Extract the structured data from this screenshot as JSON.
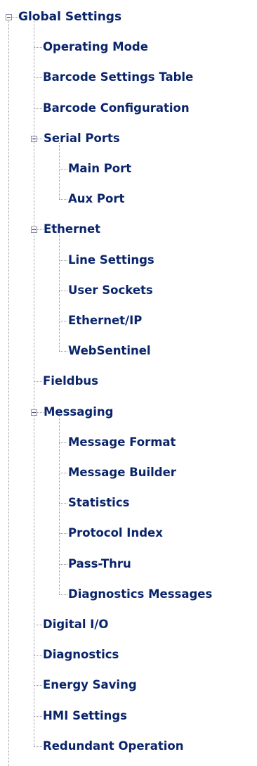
{
  "tree": {
    "colors": {
      "text": "#0a246a",
      "connector": "#9a9aa6",
      "expander_border": "#8a8aa0",
      "background": "#ffffff"
    },
    "icons": {
      "expander": "collapse-minus-box-icon"
    },
    "root": {
      "label": "Global Settings",
      "expanded": true,
      "children": [
        {
          "label": "Operating Mode"
        },
        {
          "label": "Barcode Settings Table"
        },
        {
          "label": "Barcode Configuration"
        },
        {
          "label": "Serial Ports",
          "expanded": true,
          "children": [
            {
              "label": "Main Port"
            },
            {
              "label": "Aux Port"
            }
          ]
        },
        {
          "label": "Ethernet",
          "expanded": true,
          "children": [
            {
              "label": "Line Settings"
            },
            {
              "label": "User Sockets"
            },
            {
              "label": "Ethernet/IP"
            },
            {
              "label": "WebSentinel"
            }
          ]
        },
        {
          "label": "Fieldbus"
        },
        {
          "label": "Messaging",
          "expanded": true,
          "children": [
            {
              "label": "Message Format"
            },
            {
              "label": "Message Builder"
            },
            {
              "label": "Statistics"
            },
            {
              "label": "Protocol Index"
            },
            {
              "label": "Pass-Thru"
            },
            {
              "label": "Diagnostics Messages"
            }
          ]
        },
        {
          "label": "Digital I/O"
        },
        {
          "label": "Diagnostics"
        },
        {
          "label": "Energy Saving"
        },
        {
          "label": "HMI Settings"
        },
        {
          "label": "Redundant Operation"
        }
      ]
    }
  }
}
